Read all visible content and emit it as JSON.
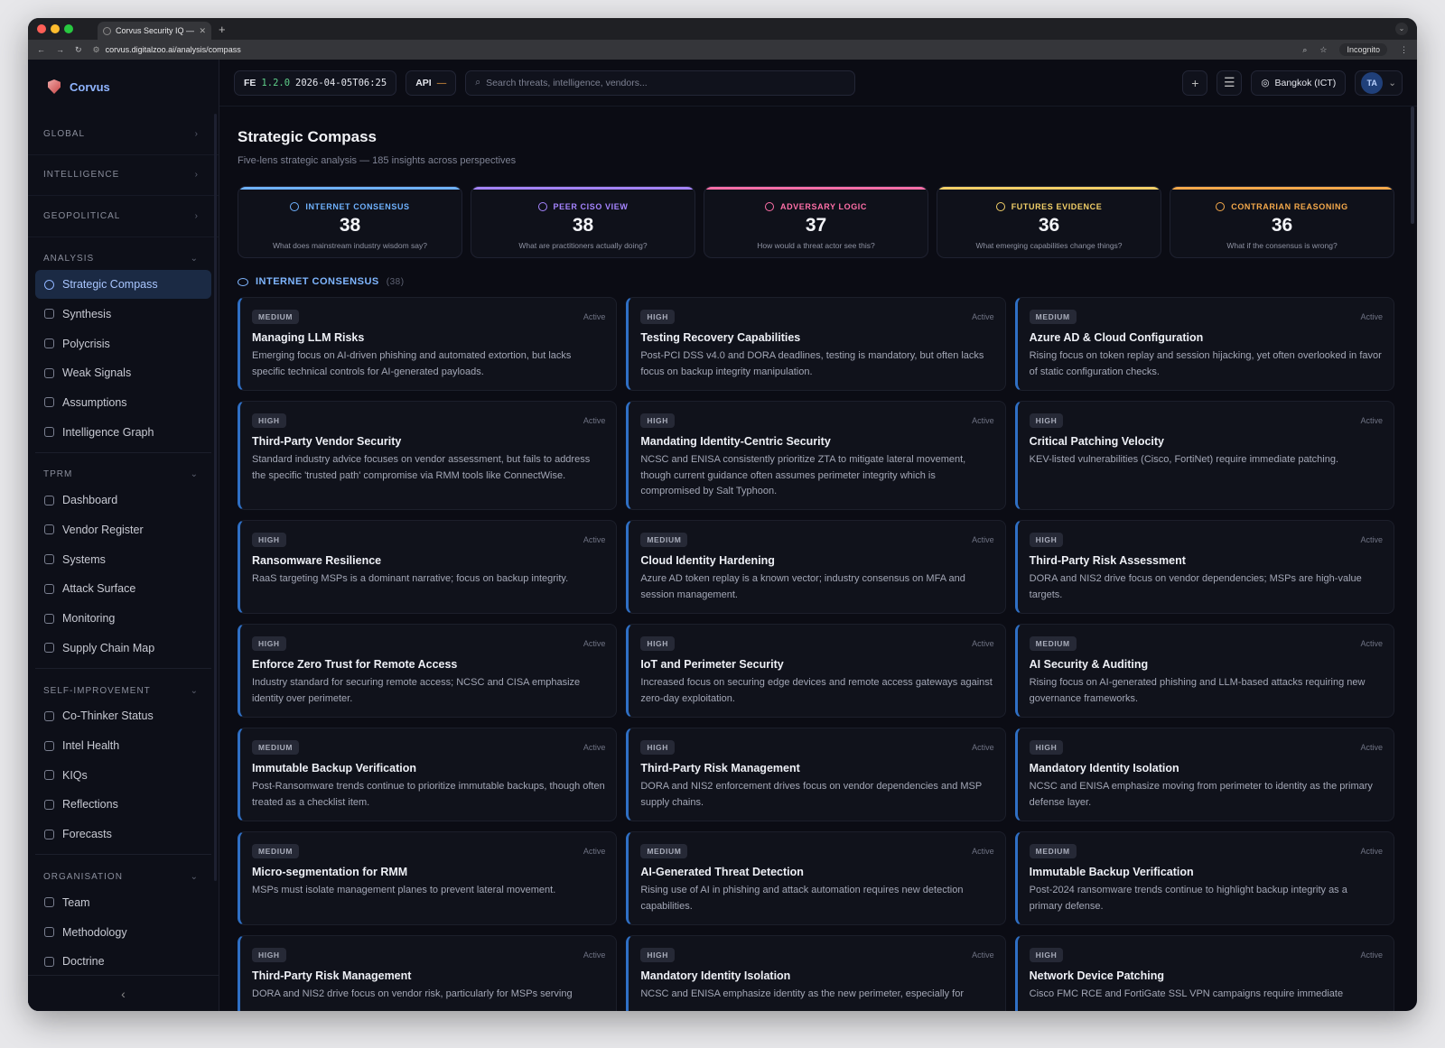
{
  "browser": {
    "tab_title": "Corvus Security IQ — AI-Pow",
    "url": "corvus.digitalzoo.ai/analysis/compass",
    "incognito": "Incognito",
    "traffic": [
      "#ff5f57",
      "#febc2e",
      "#28c840"
    ]
  },
  "brand": {
    "name": "Corvus"
  },
  "sidebar": {
    "collapsed_sections": [
      "GLOBAL",
      "INTELLIGENCE",
      "GEOPOLITICAL"
    ],
    "groups": [
      {
        "label": "ANALYSIS",
        "items": [
          {
            "label": "Strategic Compass",
            "icon": "compass-icon",
            "active": true
          },
          {
            "label": "Synthesis",
            "icon": "flask-icon"
          },
          {
            "label": "Polycrisis",
            "icon": "waves-icon"
          },
          {
            "label": "Weak Signals",
            "icon": "bolt-icon"
          },
          {
            "label": "Assumptions",
            "icon": "question-icon"
          },
          {
            "label": "Intelligence Graph",
            "icon": "graph-icon"
          }
        ]
      },
      {
        "label": "TPRM",
        "items": [
          {
            "label": "Dashboard",
            "icon": "dashboard-icon"
          },
          {
            "label": "Vendor Register",
            "icon": "search-icon"
          },
          {
            "label": "Systems",
            "icon": "monitor-icon"
          },
          {
            "label": "Attack Surface",
            "icon": "scan-icon"
          },
          {
            "label": "Monitoring",
            "icon": "eye-icon"
          },
          {
            "label": "Supply Chain Map",
            "icon": "branch-icon"
          }
        ]
      },
      {
        "label": "SELF-IMPROVEMENT",
        "items": [
          {
            "label": "Co-Thinker Status",
            "icon": "brain-icon"
          },
          {
            "label": "Intel Health",
            "icon": "pulse-icon"
          },
          {
            "label": "KIQs",
            "icon": "message-icon"
          },
          {
            "label": "Reflections",
            "icon": "book-icon"
          },
          {
            "label": "Forecasts",
            "icon": "trend-icon"
          }
        ]
      },
      {
        "label": "ORGANISATION",
        "items": [
          {
            "label": "Team",
            "icon": "users-icon"
          },
          {
            "label": "Methodology",
            "icon": "target-icon"
          },
          {
            "label": "Doctrine",
            "icon": "doc-icon"
          }
        ]
      }
    ]
  },
  "topbar": {
    "fe_label": "FE",
    "version": "1.2.0",
    "timestamp": "2026-04-05T06:25",
    "api_label": "API",
    "api_status": "—",
    "search_placeholder": "Search threats, intelligence, vendors...",
    "timezone": "Bangkok (ICT)",
    "avatar": "TA"
  },
  "page": {
    "title": "Strategic Compass",
    "subtitle": "Five-lens strategic analysis — 185 insights across perspectives"
  },
  "lenses": [
    {
      "name": "INTERNET CONSENSUS",
      "count": "38",
      "question": "What does mainstream industry wisdom say?",
      "color": "#6fb2ff"
    },
    {
      "name": "PEER CISO VIEW",
      "count": "38",
      "question": "What are practitioners actually doing?",
      "color": "#a584ff"
    },
    {
      "name": "ADVERSARY LOGIC",
      "count": "37",
      "question": "How would a threat actor see this?",
      "color": "#ff6fa8"
    },
    {
      "name": "FUTURES EVIDENCE",
      "count": "36",
      "question": "What emerging capabilities change things?",
      "color": "#f3d068"
    },
    {
      "name": "CONTRARIAN REASONING",
      "count": "36",
      "question": "What if the consensus is wrong?",
      "color": "#f5a94b"
    }
  ],
  "category": {
    "name": "INTERNET CONSENSUS",
    "count": "(38)"
  },
  "cards": [
    {
      "level": "MEDIUM",
      "status": "Active",
      "title": "Managing LLM Risks",
      "desc": "Emerging focus on AI-driven phishing and automated extortion, but lacks specific technical controls for AI-generated payloads."
    },
    {
      "level": "HIGH",
      "status": "Active",
      "title": "Testing Recovery Capabilities",
      "desc": "Post-PCI DSS v4.0 and DORA deadlines, testing is mandatory, but often lacks focus on backup integrity manipulation."
    },
    {
      "level": "MEDIUM",
      "status": "Active",
      "title": "Azure AD & Cloud Configuration",
      "desc": "Rising focus on token replay and session hijacking, yet often overlooked in favor of static configuration checks."
    },
    {
      "level": "HIGH",
      "status": "Active",
      "title": "Third-Party Vendor Security",
      "desc": "Standard industry advice focuses on vendor assessment, but fails to address the specific 'trusted path' compromise via RMM tools like ConnectWise."
    },
    {
      "level": "HIGH",
      "status": "Active",
      "title": "Mandating Identity-Centric Security",
      "desc": "NCSC and ENISA consistently prioritize ZTA to mitigate lateral movement, though current guidance often assumes perimeter integrity which is compromised by Salt Typhoon."
    },
    {
      "level": "HIGH",
      "status": "Active",
      "title": "Critical Patching Velocity",
      "desc": "KEV-listed vulnerabilities (Cisco, FortiNet) require immediate patching."
    },
    {
      "level": "HIGH",
      "status": "Active",
      "title": "Ransomware Resilience",
      "desc": "RaaS targeting MSPs is a dominant narrative; focus on backup integrity."
    },
    {
      "level": "MEDIUM",
      "status": "Active",
      "title": "Cloud Identity Hardening",
      "desc": "Azure AD token replay is a known vector; industry consensus on MFA and session management."
    },
    {
      "level": "HIGH",
      "status": "Active",
      "title": "Third-Party Risk Assessment",
      "desc": "DORA and NIS2 drive focus on vendor dependencies; MSPs are high-value targets."
    },
    {
      "level": "HIGH",
      "status": "Active",
      "title": "Enforce Zero Trust for Remote Access",
      "desc": "Industry standard for securing remote access; NCSC and CISA emphasize identity over perimeter."
    },
    {
      "level": "HIGH",
      "status": "Active",
      "title": "IoT and Perimeter Security",
      "desc": "Increased focus on securing edge devices and remote access gateways against zero-day exploitation."
    },
    {
      "level": "MEDIUM",
      "status": "Active",
      "title": "AI Security & Auditing",
      "desc": "Rising focus on AI-generated phishing and LLM-based attacks requiring new governance frameworks."
    },
    {
      "level": "MEDIUM",
      "status": "Active",
      "title": "Immutable Backup Verification",
      "desc": "Post-Ransomware trends continue to prioritize immutable backups, though often treated as a checklist item."
    },
    {
      "level": "HIGH",
      "status": "Active",
      "title": "Third-Party Risk Management",
      "desc": "DORA and NIS2 enforcement drives focus on vendor dependencies and MSP supply chains."
    },
    {
      "level": "HIGH",
      "status": "Active",
      "title": "Mandatory Identity Isolation",
      "desc": "NCSC and ENISA emphasize moving from perimeter to identity as the primary defense layer."
    },
    {
      "level": "MEDIUM",
      "status": "Active",
      "title": "Micro-segmentation for RMM",
      "desc": "MSPs must isolate management planes to prevent lateral movement."
    },
    {
      "level": "MEDIUM",
      "status": "Active",
      "title": "AI-Generated Threat Detection",
      "desc": "Rising use of AI in phishing and attack automation requires new detection capabilities."
    },
    {
      "level": "MEDIUM",
      "status": "Active",
      "title": "Immutable Backup Verification",
      "desc": "Post-2024 ransomware trends continue to highlight backup integrity as a primary defense."
    },
    {
      "level": "HIGH",
      "status": "Active",
      "title": "Third-Party Risk Management",
      "desc": "DORA and NIS2 drive focus on vendor risk, particularly for MSPs serving"
    },
    {
      "level": "HIGH",
      "status": "Active",
      "title": "Mandatory Identity Isolation",
      "desc": "NCSC and ENISA emphasize identity as the new perimeter, especially for"
    },
    {
      "level": "HIGH",
      "status": "Active",
      "title": "Network Device Patching",
      "desc": "Cisco FMC RCE and FortiGate SSL VPN campaigns require immediate"
    }
  ]
}
